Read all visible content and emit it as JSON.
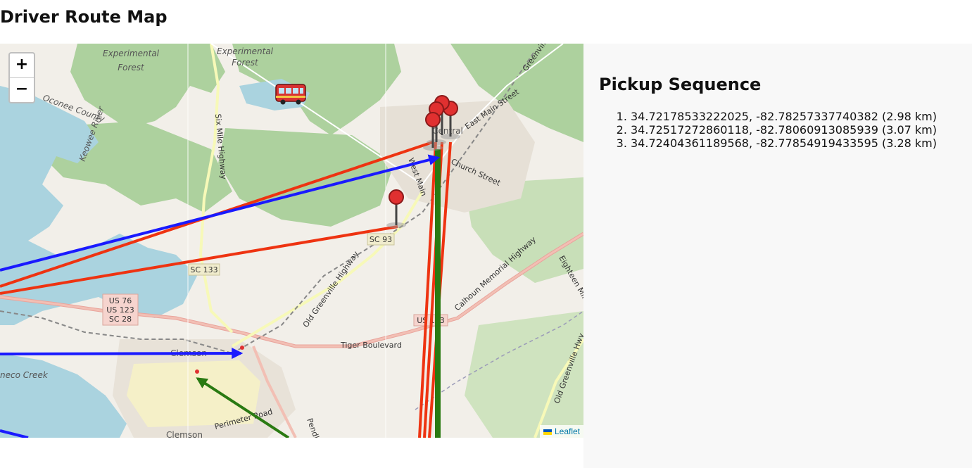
{
  "page": {
    "title": "Driver Route Map"
  },
  "map": {
    "zoom_in_label": "+",
    "zoom_out_label": "−",
    "attribution": "Leaflet",
    "place_labels": {
      "experimental_forest_1a": "Experimental",
      "experimental_forest_1b": "Forest",
      "experimental_forest_2a": "Experimental",
      "experimental_forest_2b": "Forest",
      "clemson_1": "Clemson",
      "clemson_2": "Clemson",
      "central": "Central",
      "seneca_creek": "neco Creek",
      "keowee_river": "Keowee River",
      "oconee_county": "Oconee County"
    },
    "road_labels": {
      "sc93": "SC 93",
      "sc133": "SC 133",
      "us76_a": "US 76",
      "us76_b": "US 123",
      "us76_c": "SC 28",
      "us123": "US 123",
      "tiger_blvd": "Tiger Boulevard",
      "old_greenville": "Old Greenville Highway",
      "calhoun": "Calhoun Memorial Highway",
      "six_mile": "Six Mile Highway",
      "perimeter": "Perimeter Road",
      "pendleton": "Pendleton",
      "eighteen_mile": "Eighteen Mile",
      "old_greenville_2": "Old Greenville Hwy",
      "east_main": "East Main Street",
      "west_main": "West Main",
      "church_st": "Church Street",
      "greenville_hwy": "Greenville Hwy"
    },
    "route_colors": {
      "blue": "#1a1aff",
      "red": "#ee3311",
      "green": "#2a7a12"
    },
    "icons": [
      "bus-icon",
      "map-pin-icon"
    ]
  },
  "sidebar": {
    "heading": "Pickup Sequence",
    "items": [
      "34.72178533222025, -82.78257337740382 (2.98 km)",
      "34.72517272860118, -82.78060913085939 (3.07 km)",
      "34.72404361189568, -82.77854919433595 (3.28 km)"
    ]
  }
}
